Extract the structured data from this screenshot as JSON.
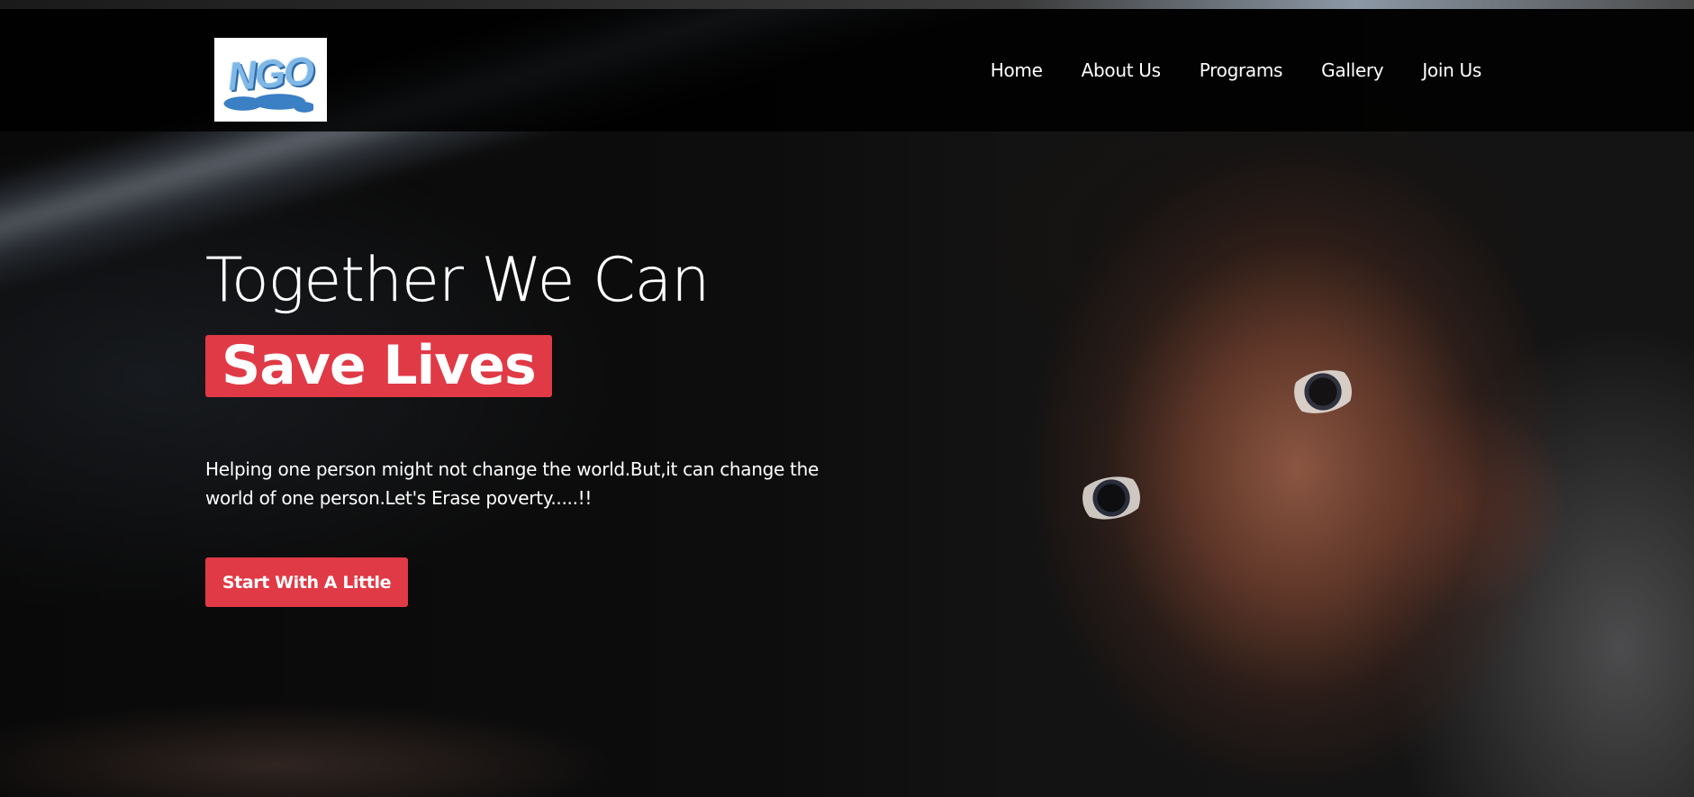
{
  "header": {
    "logo_text": "NGO",
    "nav": [
      {
        "label": "Home"
      },
      {
        "label": "About Us"
      },
      {
        "label": "Programs"
      },
      {
        "label": "Gallery"
      },
      {
        "label": "Join Us"
      }
    ]
  },
  "hero": {
    "title_line1": "Together We Can",
    "title_line2": "Save Lives",
    "text": "Helping one person might not change the world.But,it can change the world of one person.Let's Erase poverty.....!!",
    "cta_label": "Start With A Little"
  },
  "colors": {
    "accent": "#e03a46",
    "header_bg": "#000000",
    "text": "#ffffff"
  },
  "icons": {
    "logo": "ngo-logo-icon"
  }
}
